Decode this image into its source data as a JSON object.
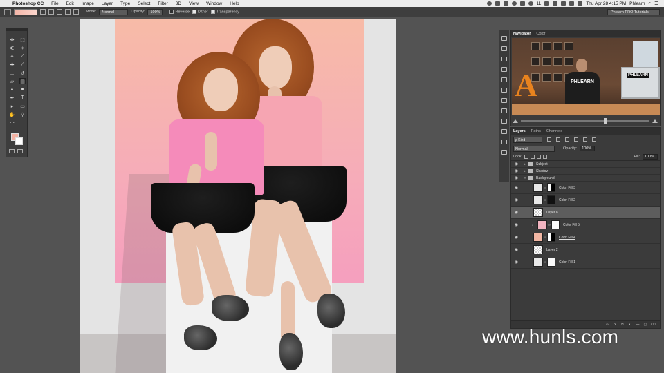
{
  "menubar": {
    "app_name": "Photoshop CC",
    "items": [
      "File",
      "Edit",
      "Image",
      "Layer",
      "Type",
      "Select",
      "Filter",
      "3D",
      "View",
      "Window",
      "Help"
    ],
    "status_num": "11",
    "clock": "Thu Apr 28  4:15 PM",
    "user": "Phlearn"
  },
  "options": {
    "mode_label": "Mode:",
    "mode_value": "Normal",
    "opacity_label": "Opacity:",
    "opacity_value": "100%",
    "reverse_label": "Reverse",
    "dither_label": "Dither",
    "transparency_label": "Transparency",
    "workspace": "Phlearn PRO Tutorials"
  },
  "tools": {
    "foreground_color": "#f3b2a3",
    "background_color": "#ffffff"
  },
  "navigator": {
    "tabs": [
      "Navigator",
      "Color"
    ],
    "preview_logo": "PHLEARN",
    "preview_letter": "A",
    "preview_screen_text": "PHLEARN"
  },
  "layers_panel": {
    "tabs": [
      "Layers",
      "Paths",
      "Channels"
    ],
    "filter_kind": "ρ Kind",
    "blend_mode": "Normal",
    "opacity_label": "Opacity:",
    "opacity_value": "100%",
    "lock_label": "Lock:",
    "fill_label": "Fill:",
    "fill_value": "100%",
    "layers": [
      {
        "name": "Subject",
        "type": "group"
      },
      {
        "name": "Shadow",
        "type": "group"
      },
      {
        "name": "Background",
        "type": "group-open"
      },
      {
        "name": "Color Fill 3",
        "type": "fill"
      },
      {
        "name": "Color Fill 2",
        "type": "fill"
      },
      {
        "name": "Layer 8",
        "type": "pixel"
      },
      {
        "name": "Color Fill 5",
        "type": "fill"
      },
      {
        "name": "Color Fill 4",
        "type": "fill"
      },
      {
        "name": "Layer 2",
        "type": "pixel"
      },
      {
        "name": "Color Fill 1",
        "type": "fill"
      }
    ],
    "footer_icons": [
      "link-icon",
      "fx-icon",
      "mask-icon",
      "adjustment-icon",
      "folder-icon",
      "new-layer-icon",
      "trash-icon"
    ]
  },
  "watermark": "www.hunls.com"
}
